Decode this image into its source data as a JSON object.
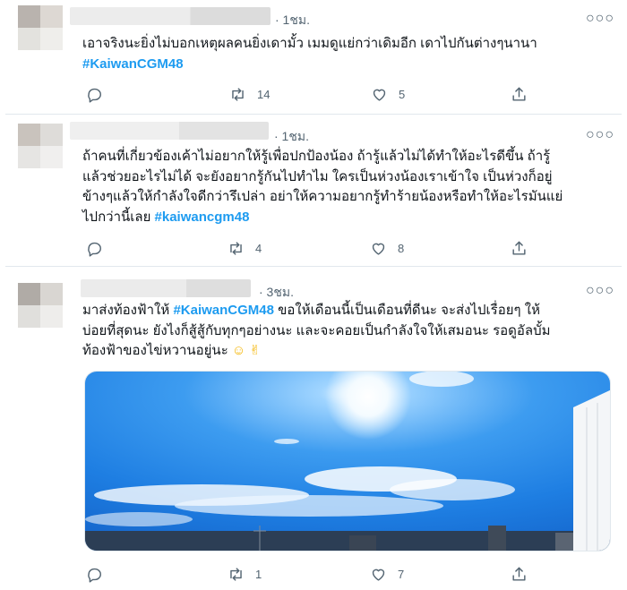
{
  "tweets": [
    {
      "time": "· 1ชม.",
      "lines": [
        "เอาจริงนะยิ่งไม่บอกเหตุผลคนยิ่งเดามั้ว เมมดูแย่กว่าเดิมอีก เดาไปกันต่างๆนานา"
      ],
      "hashtag": "#KaiwanCGM48",
      "reply_count": "",
      "retweet_count": "14",
      "like_count": "5"
    },
    {
      "time": "· 1ชม.",
      "lines": [
        "ถ้าคนที่เกี่ยวข้องเค้าไม่อยากให้รู้เพื่อปกป้องน้อง ถ้ารู้แล้วไม่ได้ทำให้อะไรดีขึ้น ถ้ารู้",
        "แล้วช่วยอะไรไม่ได้ จะยังอยากรู้กันไปทำไม ใครเป็นห่วงน้องเราเข้าใจ เป็นห่วงก็อยู่",
        "ข้างๆแล้วให้กำลังใจดีกว่ารึเปล่า อย่าให้ความอยากรู้ทำร้ายน้องหรือทำให้อะไรมันแย่",
        "ไปกว่านี้เลย"
      ],
      "hashtag": "#kaiwancgm48",
      "reply_count": "",
      "retweet_count": "4",
      "like_count": "8"
    },
    {
      "time": "· 3ชม.",
      "line1_prefix": "มาส่งท้องฟ้าให้",
      "hashtag": "#KaiwanCGM48",
      "line1_suffix": "ขอให้เดือนนี้เป็นเดือนที่ดีนะ จะส่งไปเรื่อยๆ ให้",
      "lines": [
        "บ่อยที่สุดนะ ยังไงก็สู้สู้กับทุกๆอย่างนะ และจะคอยเป็นกำลังใจให้เสมอนะ รอดูอัลบั้ม",
        "ท้องฟ้าของไข่หวานอยู่นะ"
      ],
      "emoji": "☺ ✌",
      "reply_count": "",
      "retweet_count": "1",
      "like_count": "7"
    }
  ],
  "icons": {
    "reply": "reply-icon",
    "retweet": "retweet-icon",
    "like": "heart-icon",
    "share": "share-icon",
    "more": "more-dots-icon"
  },
  "colors": {
    "hashtag": "#1d9bf0",
    "muted": "#536471",
    "border": "#e1e8ed"
  }
}
